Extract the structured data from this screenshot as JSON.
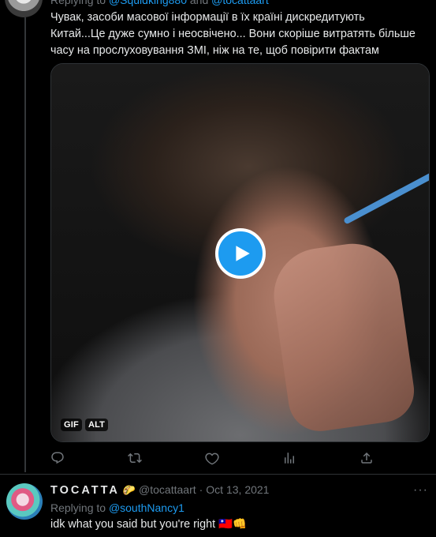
{
  "top_tweet": {
    "replying_prefix": "Replying to ",
    "replying_handle_1": "@Squidking880",
    "replying_join": " and ",
    "replying_handle_2": "@tocattaart",
    "text": "Чувак, засоби масової інформації в їх країні дискредитують Китай...Це дуже сумно і неосвічено... Вони скоріше витратять більше часу на прослуховування ЗМІ, ніж на те, щоб повірити фактам",
    "media": {
      "badge_gif": "GIF",
      "badge_alt": "ALT",
      "play_icon": "play-icon"
    },
    "actions": [
      "reply-icon",
      "retweet-icon",
      "like-icon",
      "views-icon",
      "share-icon"
    ]
  },
  "reply_tweet": {
    "display_name": "TOCATTA",
    "name_emoji": "🌮",
    "handle": "@tocattaart",
    "separator": " · ",
    "date": "Oct 13, 2021",
    "more": "···",
    "replying_prefix": "Replying to ",
    "replying_handle": "@southNancy1",
    "text": "idk what you said but you're right 🇹🇼👊"
  },
  "colors": {
    "background": "#000000",
    "text": "#e7e9ea",
    "muted": "#71767b",
    "accent": "#1d9bf0",
    "border": "#2f3336"
  }
}
